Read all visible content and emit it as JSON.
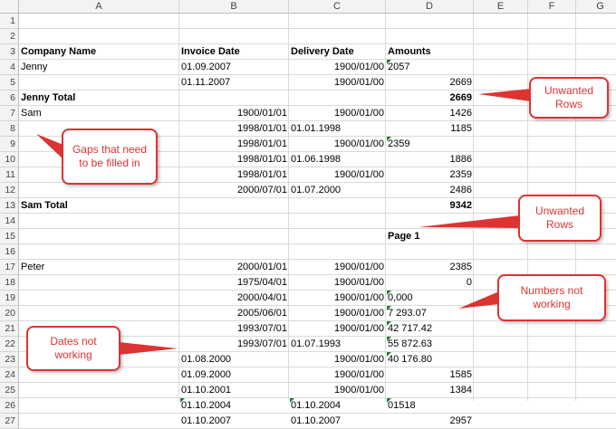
{
  "columns": [
    "A",
    "B",
    "C",
    "D",
    "E",
    "F",
    "G"
  ],
  "rows": [
    {
      "num": "1",
      "cells": [
        "",
        "",
        "",
        ""
      ]
    },
    {
      "num": "2",
      "cells": [
        "",
        "",
        "",
        ""
      ]
    },
    {
      "num": "3",
      "cells": [
        "Company Name",
        "Invoice Date",
        "Delivery Date",
        "Amounts"
      ]
    },
    {
      "num": "4",
      "cells": [
        "Jenny",
        "01.09.2007",
        "1900/01/00",
        "2057"
      ]
    },
    {
      "num": "5",
      "cells": [
        "",
        "01.11.2007",
        "1900/01/00",
        "2669"
      ]
    },
    {
      "num": "6",
      "cells": [
        "Jenny Total",
        "",
        "",
        "2669"
      ]
    },
    {
      "num": "7",
      "cells": [
        "Sam",
        "1900/01/01",
        "1900/01/00",
        "1426"
      ]
    },
    {
      "num": "8",
      "cells": [
        "",
        "1998/01/01",
        "01.01.1998",
        "1185"
      ]
    },
    {
      "num": "9",
      "cells": [
        "",
        "1998/01/01",
        "1900/01/00",
        "2359"
      ]
    },
    {
      "num": "10",
      "cells": [
        "",
        "1998/01/01",
        "01.06.1998",
        "1886"
      ]
    },
    {
      "num": "11",
      "cells": [
        "",
        "1998/01/01",
        "1900/01/00",
        "2359"
      ]
    },
    {
      "num": "12",
      "cells": [
        "",
        "2000/07/01",
        "01.07.2000",
        "2486"
      ]
    },
    {
      "num": "13",
      "cells": [
        "Sam   Total",
        "",
        "",
        "9342"
      ]
    },
    {
      "num": "14",
      "cells": [
        "",
        "",
        "",
        ""
      ]
    },
    {
      "num": "15",
      "cells": [
        "",
        "",
        "",
        "Page 1"
      ]
    },
    {
      "num": "16",
      "cells": [
        "",
        "",
        "",
        ""
      ]
    },
    {
      "num": "17",
      "cells": [
        "Peter",
        "2000/01/01",
        "1900/01/00",
        "2385"
      ]
    },
    {
      "num": "18",
      "cells": [
        "",
        "1975/04/01",
        "1900/01/00",
        "0"
      ]
    },
    {
      "num": "19",
      "cells": [
        "",
        "2000/04/01",
        "1900/01/00",
        "0,000"
      ]
    },
    {
      "num": "20",
      "cells": [
        "",
        "2005/06/01",
        "1900/01/00",
        "7 293.07"
      ]
    },
    {
      "num": "21",
      "cells": [
        "",
        "1993/07/01",
        "1900/01/00",
        "42 717.42"
      ]
    },
    {
      "num": "22",
      "cells": [
        "",
        "1993/07/01",
        "01.07.1993",
        "55 872.63"
      ]
    },
    {
      "num": "23",
      "cells": [
        "",
        "01.08.2000",
        "1900/01/00",
        "40 176.80"
      ]
    },
    {
      "num": "24",
      "cells": [
        "",
        "01.09.2000",
        "1900/01/00",
        "1585"
      ]
    },
    {
      "num": "25",
      "cells": [
        "",
        "01.10.2001",
        "1900/01/00",
        "1384"
      ]
    },
    {
      "num": "26",
      "cells": [
        "",
        "01.10.2004",
        "01.10.2004",
        "01518"
      ]
    },
    {
      "num": "27",
      "cells": [
        "",
        "01.10.2007",
        "01.10.2007",
        "2957"
      ]
    }
  ],
  "callouts": {
    "unwanted_rows_1": "Unwanted Rows",
    "gaps": "Gaps that need to be filled in",
    "unwanted_rows_2": "Unwanted Rows",
    "numbers": "Numbers not working",
    "dates": "Dates not working"
  },
  "colors": {
    "callout": "#dd3333",
    "header_bg": "#f3f3f3",
    "error_marker": "#1e7b34"
  }
}
